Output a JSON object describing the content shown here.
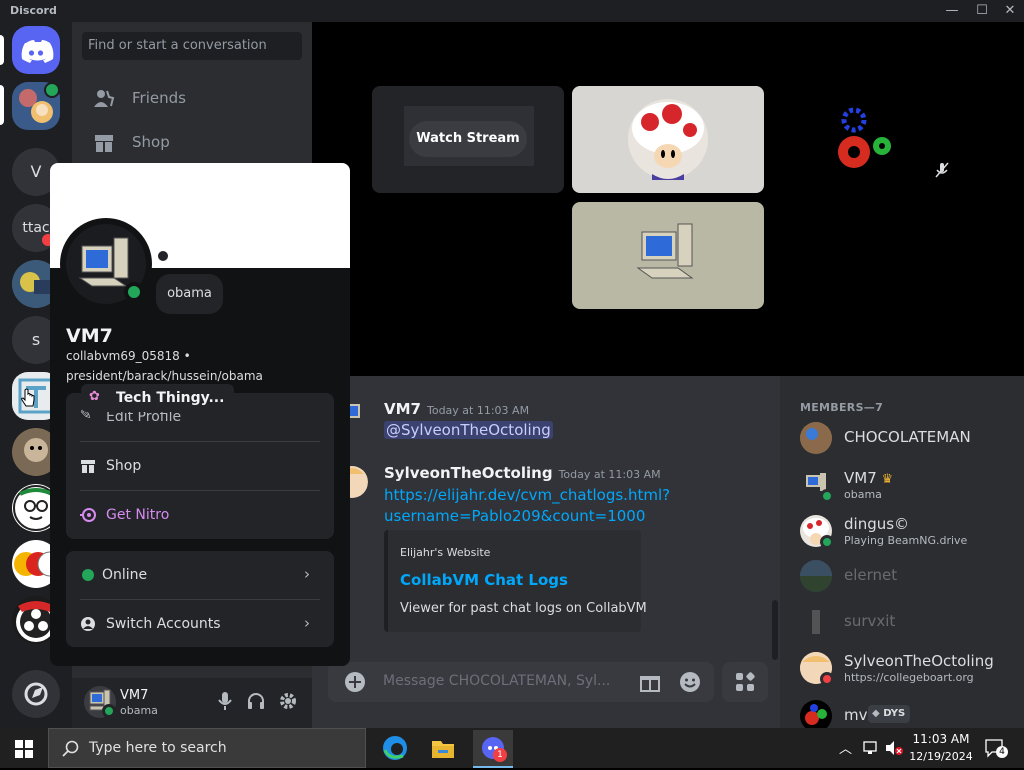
{
  "app": {
    "name": "Discord"
  },
  "guilds": [
    {
      "label": ""
    },
    {
      "label": "V"
    },
    {
      "label": "ttac"
    },
    {
      "label": "s"
    }
  ],
  "sidebar": {
    "search_placeholder": "Find or start a conversation",
    "items": [
      {
        "label": "Friends"
      },
      {
        "label": "Shop"
      }
    ]
  },
  "stage": {
    "watch_stream_label": "Watch Stream"
  },
  "chat": {
    "messages": [
      {
        "author": "VM7",
        "time": "Today at 11:03 AM",
        "mention": "@SylveonTheOctoling"
      },
      {
        "author": "SylveonTheOctoling",
        "time": "Today at 11:03 AM",
        "link_line1": "https://elijahr.dev/cvm_chatlogs.html?",
        "link_line2": "username=Pablo209&count=1000"
      }
    ],
    "embed": {
      "provider": "Elijahr's Website",
      "title": "CollabVM Chat Logs",
      "description": "Viewer for past chat logs on CollabVM"
    },
    "input_placeholder": "Message CHOCOLATEMAN, Syl..."
  },
  "members": {
    "header": "MEMBERS—7",
    "list": [
      {
        "name": "CHOCOLATEMAN",
        "status": ""
      },
      {
        "name": "VM7",
        "status": "obama"
      },
      {
        "name": "dingus©",
        "status": "Playing BeamNG.drive"
      },
      {
        "name": "elernet",
        "status": ""
      },
      {
        "name": "survxit",
        "status": ""
      },
      {
        "name": "SylveonTheOctoling",
        "status": "https://collegeboart.org"
      },
      {
        "name": "mv",
        "status": "",
        "tag": "DYS"
      }
    ]
  },
  "popout": {
    "display_name": "VM7",
    "username_line": "collabvm69_05818 •",
    "pronouns_line": "president/barack/hussein/obama",
    "status_bubble": "obama",
    "server_tag": "Tech Thingy...",
    "edit_profile": "Edit Profile",
    "shop": "Shop",
    "get_nitro": "Get Nitro",
    "online": "Online",
    "switch_accounts": "Switch Accounts"
  },
  "userpanel": {
    "name": "VM7",
    "status": "obama"
  },
  "taskbar": {
    "search_placeholder": "Type here to search",
    "time": "11:03 AM",
    "date": "12/19/2024",
    "notifications": "4",
    "discord_badge": "1"
  },
  "colors": {
    "accent": "#5865f2",
    "online": "#23a55a",
    "link": "#00a8fc",
    "nitro": "#d68bf0"
  }
}
